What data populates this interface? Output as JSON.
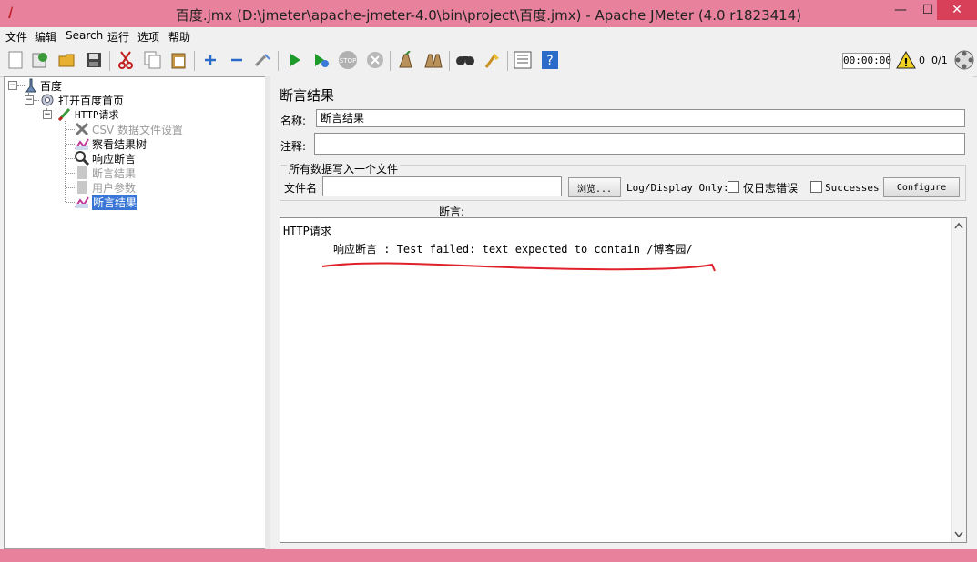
{
  "window": {
    "title": "百度.jmx (D:\\jmeter\\apache-jmeter-4.0\\bin\\project\\百度.jmx) - Apache JMeter (4.0 r1823414)",
    "minimize": "—",
    "maximize": "☐",
    "close": "✕"
  },
  "menu": [
    "文件",
    "编辑",
    "Search",
    "运行",
    "选项",
    "帮助"
  ],
  "toolbar": {
    "icons": [
      "new-icon",
      "templates-icon",
      "open-icon",
      "save-icon",
      "cut-icon",
      "copy-icon",
      "paste-icon",
      "expand-icon",
      "collapse-icon",
      "toggle-icon",
      "start-icon",
      "start-no-pauses-icon",
      "stop-icon",
      "shutdown-icon",
      "clear-icon",
      "clear-all-icon",
      "search-icon",
      "reset-search-icon",
      "function-helper-icon",
      "help-icon"
    ],
    "timer": "00:00:00",
    "warning_count": "0",
    "threads": "0/1"
  },
  "tree": [
    {
      "label": "百度",
      "icon": "test-plan-icon"
    },
    {
      "label": "打开百度首页",
      "icon": "thread-group-icon"
    },
    {
      "label": "HTTP请求",
      "icon": "sampler-icon"
    },
    {
      "label": "CSV 数据文件设置",
      "icon": "config-icon",
      "disabled": true
    },
    {
      "label": "察看结果树",
      "icon": "listener-icon"
    },
    {
      "label": "响应断言",
      "icon": "assertion-icon"
    },
    {
      "label": "断言结果",
      "icon": "listener-icon",
      "disabled": true
    },
    {
      "label": "用户参数",
      "icon": "preprocessor-icon",
      "disabled": true
    },
    {
      "label": "断言结果",
      "icon": "listener-icon",
      "selected": true
    }
  ],
  "panel": {
    "title": "断言结果",
    "name_label": "名称:",
    "name_value": "断言结果",
    "comment_label": "注释:",
    "comment_value": "",
    "file_group_title": "所有数据写入一个文件",
    "filename_label": "文件名",
    "filename_value": "",
    "browse_button": "浏览...",
    "log_display_only": "Log/Display Only:",
    "errors_only": "仅日志错误",
    "successes": "Successes",
    "configure_button": "Configure",
    "assertions_label": "断言:",
    "result_line1": "HTTP请求",
    "result_line2": "响应断言 : Test failed: text expected to contain /博客园/"
  },
  "annotation_color": "#e0202a"
}
